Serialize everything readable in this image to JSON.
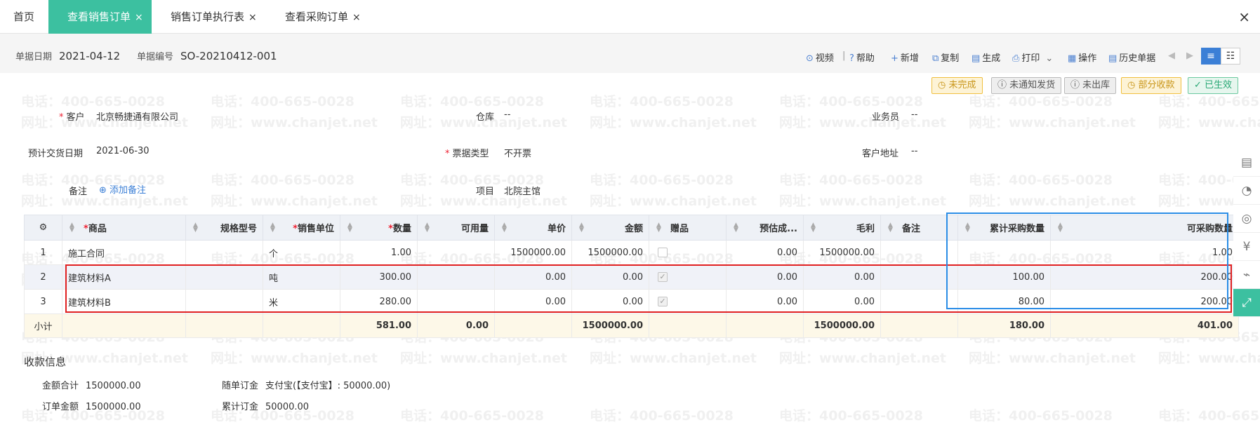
{
  "watermark": {
    "phone": "电话：400-665-0028",
    "site": "网址：www.chanjet.net"
  },
  "tabs": [
    {
      "label": "首页"
    },
    {
      "label": "查看销售订单",
      "close": "×"
    },
    {
      "label": "销售订单执行表",
      "close": "×"
    },
    {
      "label": "查看采购订单",
      "close": "×"
    }
  ],
  "window_close": "×",
  "header": {
    "date_label": "单据日期",
    "date_value": "2021-04-12",
    "no_label": "单据编号",
    "no_value": "SO-20210412-001"
  },
  "toolbar": {
    "video": "视频",
    "help": "帮助",
    "new": "新增",
    "copy": "复制",
    "generate": "生成",
    "print": "打印",
    "operate": "操作",
    "history": "历史单据"
  },
  "badges": [
    "未完成",
    "未通知发货",
    "未出库",
    "部分收款",
    "已生效"
  ],
  "colors": {
    "accent": "#3cc0a0",
    "red_box": "#e02020",
    "blue_box": "#2a8de6"
  },
  "form": {
    "customer_label": "客户",
    "customer_value": "北京畅捷通有限公司",
    "warehouse_label": "仓库",
    "warehouse_value": "--",
    "salesman_label": "业务员",
    "salesman_value": "--",
    "delivery_label": "预计交货日期",
    "delivery_value": "2021-06-30",
    "invoice_label": "票据类型",
    "invoice_value": "不开票",
    "address_label": "客户地址",
    "address_value": "--",
    "remark_label": "备注",
    "remark_add": "添加备注",
    "project_label": "项目",
    "project_value": "北院主馆"
  },
  "table": {
    "headers": {
      "product": "商品",
      "spec": "规格型号",
      "unit": "销售单位",
      "qty": "数量",
      "available": "可用量",
      "price": "单价",
      "amount": "金额",
      "gift": "赠品",
      "est_cost": "预估成...",
      "profit": "毛利",
      "note": "备注",
      "cum_purchase": "累计采购数量",
      "can_purchase": "可采购数量"
    },
    "rows": [
      {
        "no": "1",
        "product": "施工合同",
        "spec": "",
        "unit": "个",
        "qty": "1.00",
        "available": "",
        "price": "1500000.00",
        "amount": "1500000.00",
        "gift": false,
        "est_cost": "0.00",
        "profit": "1500000.00",
        "note": "",
        "cum_purchase": "",
        "can_purchase": "1.00"
      },
      {
        "no": "2",
        "product": "建筑材料A",
        "spec": "",
        "unit": "吨",
        "qty": "300.00",
        "available": "",
        "price": "0.00",
        "amount": "0.00",
        "gift": true,
        "est_cost": "0.00",
        "profit": "0.00",
        "note": "",
        "cum_purchase": "100.00",
        "can_purchase": "200.00"
      },
      {
        "no": "3",
        "product": "建筑材料B",
        "spec": "",
        "unit": "米",
        "qty": "280.00",
        "available": "",
        "price": "0.00",
        "amount": "0.00",
        "gift": true,
        "est_cost": "0.00",
        "profit": "0.00",
        "note": "",
        "cum_purchase": "80.00",
        "can_purchase": "200.00"
      }
    ],
    "subtotal": {
      "label": "小计",
      "qty": "581.00",
      "available": "0.00",
      "amount": "1500000.00",
      "profit": "1500000.00",
      "cum_purchase": "180.00",
      "can_purchase": "401.00"
    }
  },
  "payment": {
    "title": "收款信息",
    "total_label": "金额合计",
    "total_value": "1500000.00",
    "order_label": "订单金额",
    "order_value": "1500000.00",
    "deposit_label": "随单订金",
    "deposit_value": "支付宝(【支付宝】: 50000.00)",
    "cum_label": "累计订金",
    "cum_value": "50000.00"
  }
}
